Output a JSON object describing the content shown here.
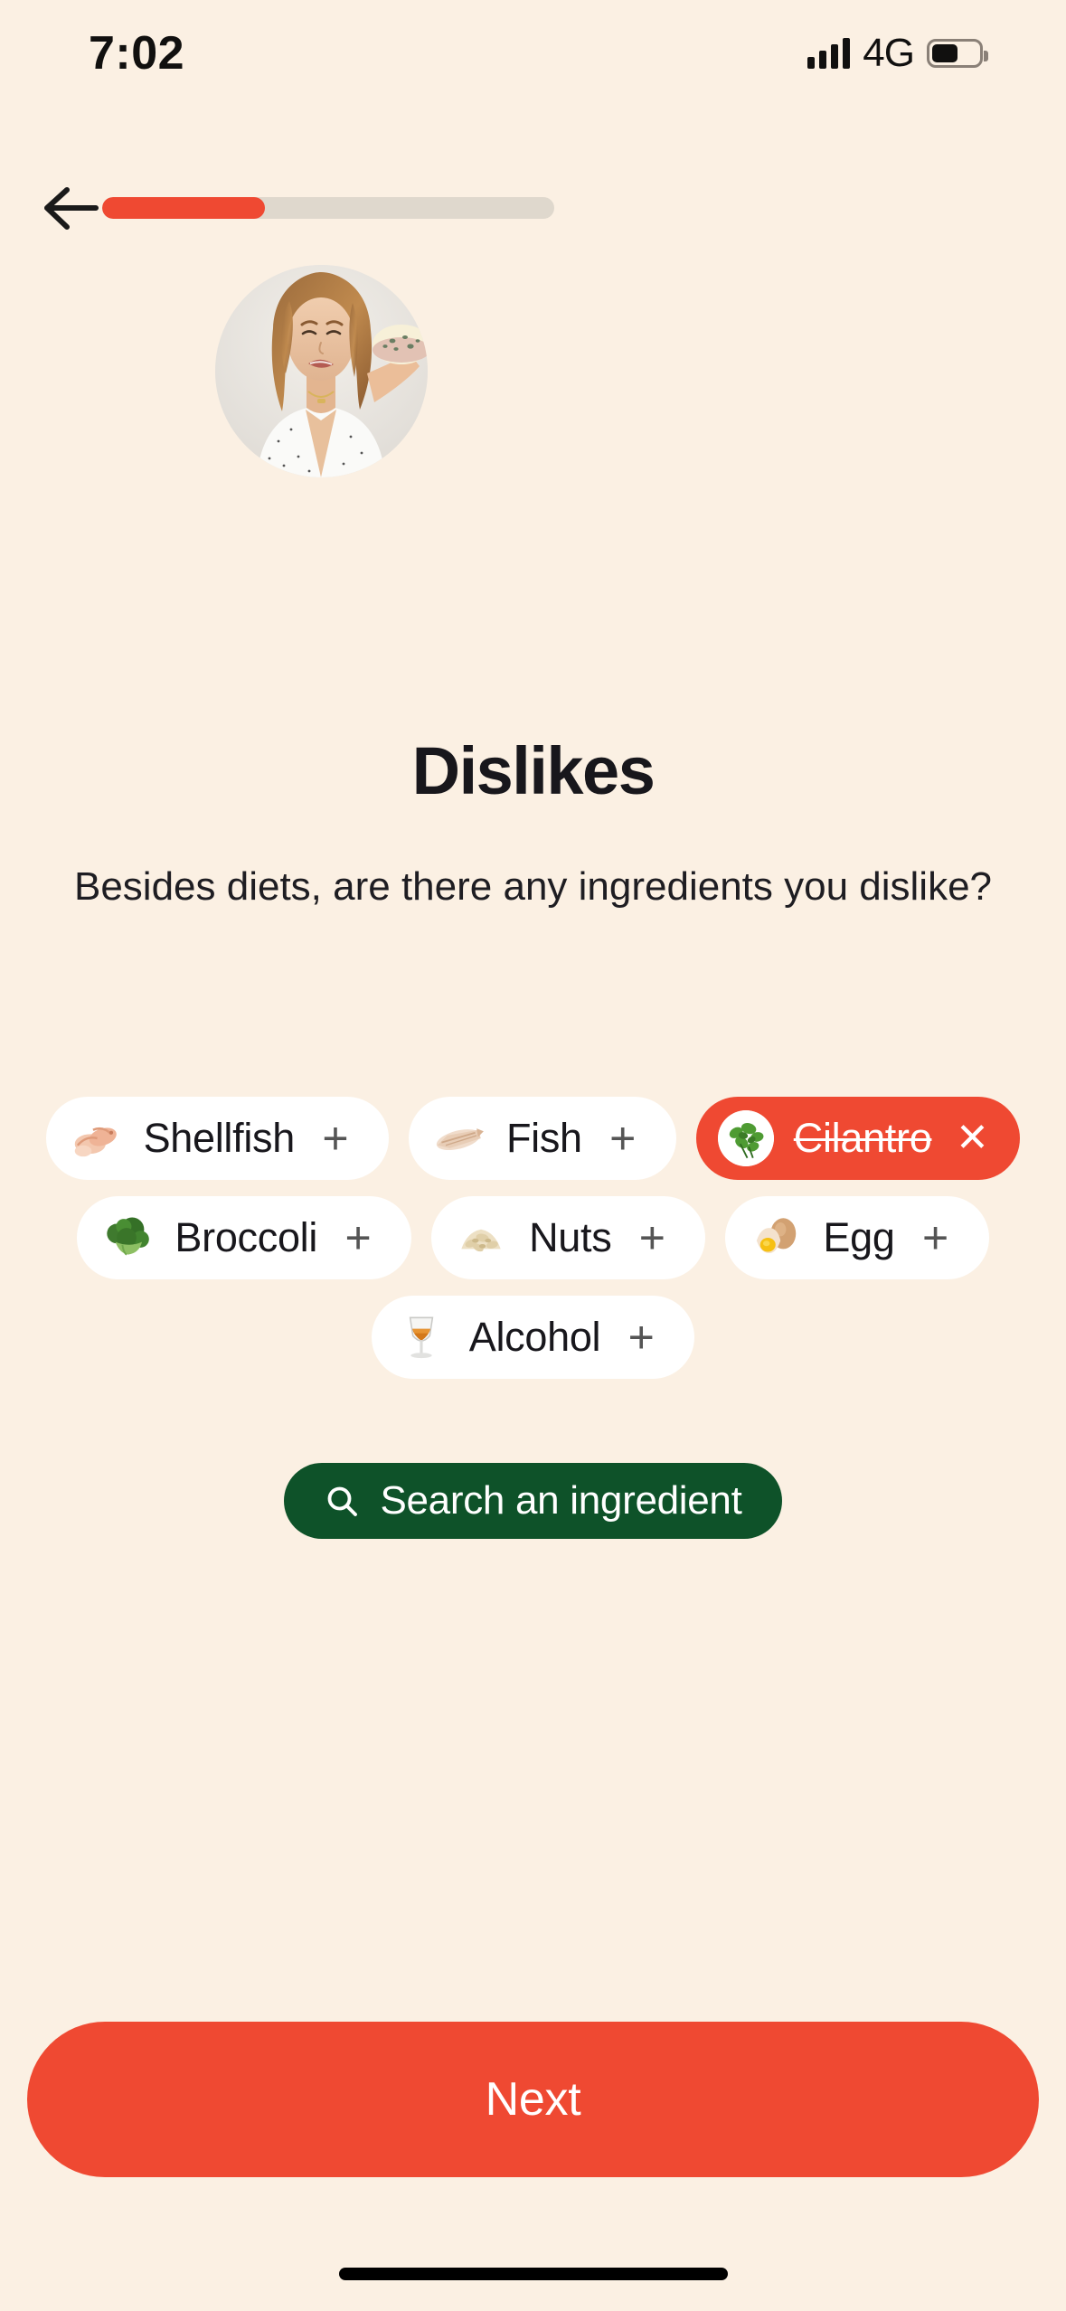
{
  "status_bar": {
    "time": "7:02",
    "network": "4G",
    "signal_icon": "cellular-signal-icon",
    "battery_icon": "battery-icon",
    "battery_level_pct": 55
  },
  "header": {
    "back_icon": "back-arrow-icon",
    "progress_pct": 36
  },
  "hero": {
    "image_alt": "woman-grimacing-holding-blue-cheese",
    "shape": "circle"
  },
  "content": {
    "title": "Dislikes",
    "subtitle": "Besides diets, are there any ingredients you dislike?"
  },
  "chips": {
    "rows": [
      [
        {
          "label": "Shellfish",
          "icon": "shellfish-icon",
          "selected": false,
          "action": "+"
        },
        {
          "label": "Fish",
          "icon": "fish-icon",
          "selected": false,
          "action": "+"
        },
        {
          "label": "Cilantro",
          "icon": "cilantro-icon",
          "selected": true,
          "action": "✕"
        }
      ],
      [
        {
          "label": "Broccoli",
          "icon": "broccoli-icon",
          "selected": false,
          "action": "+"
        },
        {
          "label": "Nuts",
          "icon": "nuts-icon",
          "selected": false,
          "action": "+"
        },
        {
          "label": "Egg",
          "icon": "egg-icon",
          "selected": false,
          "action": "+"
        }
      ],
      [
        {
          "label": "Alcohol",
          "icon": "alcohol-glass-icon",
          "selected": false,
          "action": "+"
        }
      ]
    ]
  },
  "search": {
    "label": "Search an ingredient",
    "icon": "search-icon"
  },
  "footer": {
    "next_label": "Next"
  },
  "colors": {
    "background": "#FBF0E3",
    "accent_red": "#EF4932",
    "green": "#0E5229",
    "chip_bg": "#FFFFFF",
    "track": "#DFD8CD",
    "text": "#18171C"
  }
}
